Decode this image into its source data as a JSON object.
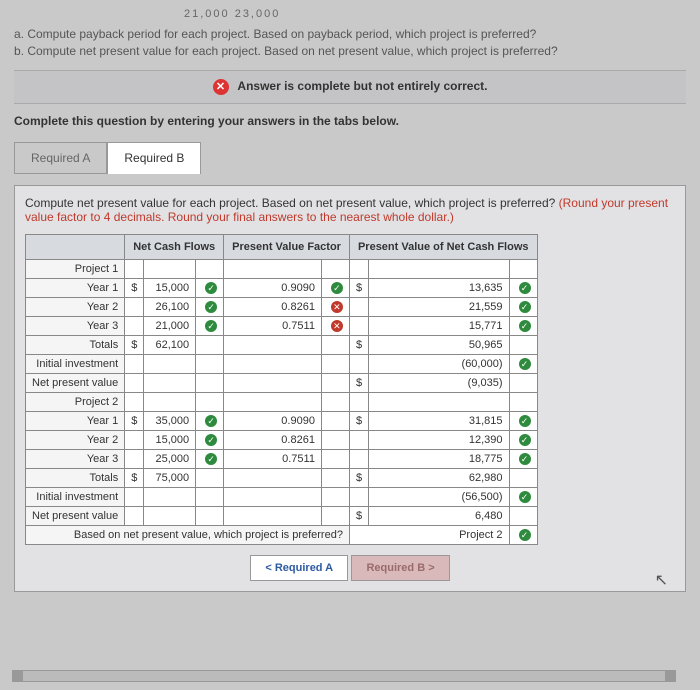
{
  "topnums": "21,000        23,000",
  "question": {
    "a": "a. Compute payback period for each project. Based on payback period, which project is preferred?",
    "b": "b. Compute net present value for each project. Based on net present value, which project is preferred?"
  },
  "status": {
    "icon": "✕",
    "text": "Answer is complete but not entirely correct."
  },
  "instruction": "Complete this question by entering your answers in the tabs below.",
  "tabs": {
    "a": "Required A",
    "b": "Required B"
  },
  "prompt": {
    "main": "Compute net present value for each project. Based on net present value, which project is preferred? ",
    "hint": "(Round your present value factor to 4 decimals. Round your final answers to the nearest whole dollar.)"
  },
  "headers": {
    "c1": "",
    "c2": "Net Cash Flows",
    "c3": "Present Value Factor",
    "c4": "Present Value of Net Cash Flows"
  },
  "rows": [
    {
      "label": "Project 1",
      "cs1": "",
      "v1": "",
      "m1": null,
      "v2": "",
      "m2": null,
      "cs3": "",
      "v3": "",
      "m3": null
    },
    {
      "label": "Year 1",
      "cs1": "$",
      "v1": "15,000",
      "m1": "ok",
      "v2": "0.9090",
      "m2": "ok",
      "cs3": "$",
      "v3": "13,635",
      "m3": "ok"
    },
    {
      "label": "Year 2",
      "cs1": "",
      "v1": "26,100",
      "m1": "ok",
      "v2": "0.8261",
      "m2": "bad",
      "cs3": "",
      "v3": "21,559",
      "m3": "ok"
    },
    {
      "label": "Year 3",
      "cs1": "",
      "v1": "21,000",
      "m1": "ok",
      "v2": "0.7511",
      "m2": "bad",
      "cs3": "",
      "v3": "15,771",
      "m3": "ok"
    },
    {
      "label": "Totals",
      "cs1": "$",
      "v1": "62,100",
      "m1": null,
      "v2": "",
      "m2": null,
      "cs3": "$",
      "v3": "50,965",
      "m3": null
    },
    {
      "label": "Initial investment",
      "cs1": "",
      "v1": "",
      "m1": null,
      "v2": "",
      "m2": null,
      "cs3": "",
      "v3": "(60,000)",
      "m3": "ok"
    },
    {
      "label": "Net present value",
      "cs1": "",
      "v1": "",
      "m1": null,
      "v2": "",
      "m2": null,
      "cs3": "$",
      "v3": "(9,035)",
      "m3": null
    },
    {
      "label": "Project 2",
      "cs1": "",
      "v1": "",
      "m1": null,
      "v2": "",
      "m2": null,
      "cs3": "",
      "v3": "",
      "m3": null
    },
    {
      "label": "Year 1",
      "cs1": "$",
      "v1": "35,000",
      "m1": "ok",
      "v2": "0.9090",
      "m2": null,
      "cs3": "$",
      "v3": "31,815",
      "m3": "ok"
    },
    {
      "label": "Year 2",
      "cs1": "",
      "v1": "15,000",
      "m1": "ok",
      "v2": "0.8261",
      "m2": null,
      "cs3": "",
      "v3": "12,390",
      "m3": "ok"
    },
    {
      "label": "Year 3",
      "cs1": "",
      "v1": "25,000",
      "m1": "ok",
      "v2": "0.7511",
      "m2": null,
      "cs3": "",
      "v3": "18,775",
      "m3": "ok"
    },
    {
      "label": "Totals",
      "cs1": "$",
      "v1": "75,000",
      "m1": null,
      "v2": "",
      "m2": null,
      "cs3": "$",
      "v3": "62,980",
      "m3": null
    },
    {
      "label": "Initial investment",
      "cs1": "",
      "v1": "",
      "m1": null,
      "v2": "",
      "m2": null,
      "cs3": "",
      "v3": "(56,500)",
      "m3": "ok"
    },
    {
      "label": "Net present value",
      "cs1": "",
      "v1": "",
      "m1": null,
      "v2": "",
      "m2": null,
      "cs3": "$",
      "v3": "6,480",
      "m3": null
    }
  ],
  "finalrow": {
    "label": "Based on net present value, which project is preferred?",
    "answer": "Project 2",
    "mark": "ok"
  },
  "nav": {
    "prev": "<  Required A",
    "next": "Required B  >"
  }
}
